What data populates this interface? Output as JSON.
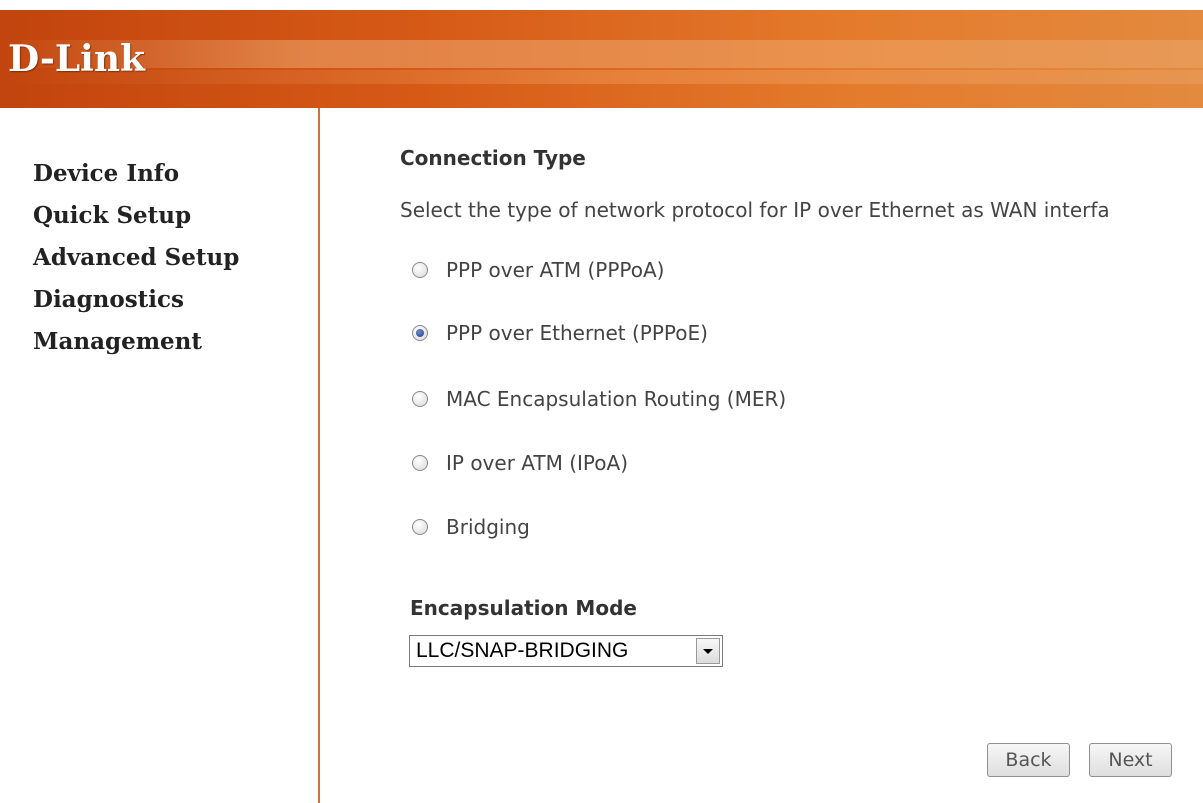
{
  "header": {
    "logo_text": "D-Link"
  },
  "sidebar": {
    "items": [
      {
        "label": "Device Info"
      },
      {
        "label": "Quick Setup"
      },
      {
        "label": "Advanced Setup"
      },
      {
        "label": "Diagnostics"
      },
      {
        "label": "Management"
      }
    ]
  },
  "main": {
    "section_title": "Connection Type",
    "description": "Select the type of network protocol for IP over Ethernet as WAN interfa",
    "options": [
      {
        "label": "PPP over ATM (PPPoA)",
        "checked": false
      },
      {
        "label": "PPP over Ethernet (PPPoE)",
        "checked": true
      },
      {
        "label": "MAC Encapsulation Routing (MER)",
        "checked": false
      },
      {
        "label": "IP over ATM (IPoA)",
        "checked": false
      },
      {
        "label": "Bridging",
        "checked": false
      }
    ],
    "encapsulation": {
      "title": "Encapsulation Mode",
      "selected": "LLC/SNAP-BRIDGING"
    },
    "buttons": {
      "back": "Back",
      "next": "Next"
    }
  },
  "colors": {
    "header_start": "#c2440e",
    "header_end": "#e38a3e",
    "divider": "#c8743a"
  }
}
